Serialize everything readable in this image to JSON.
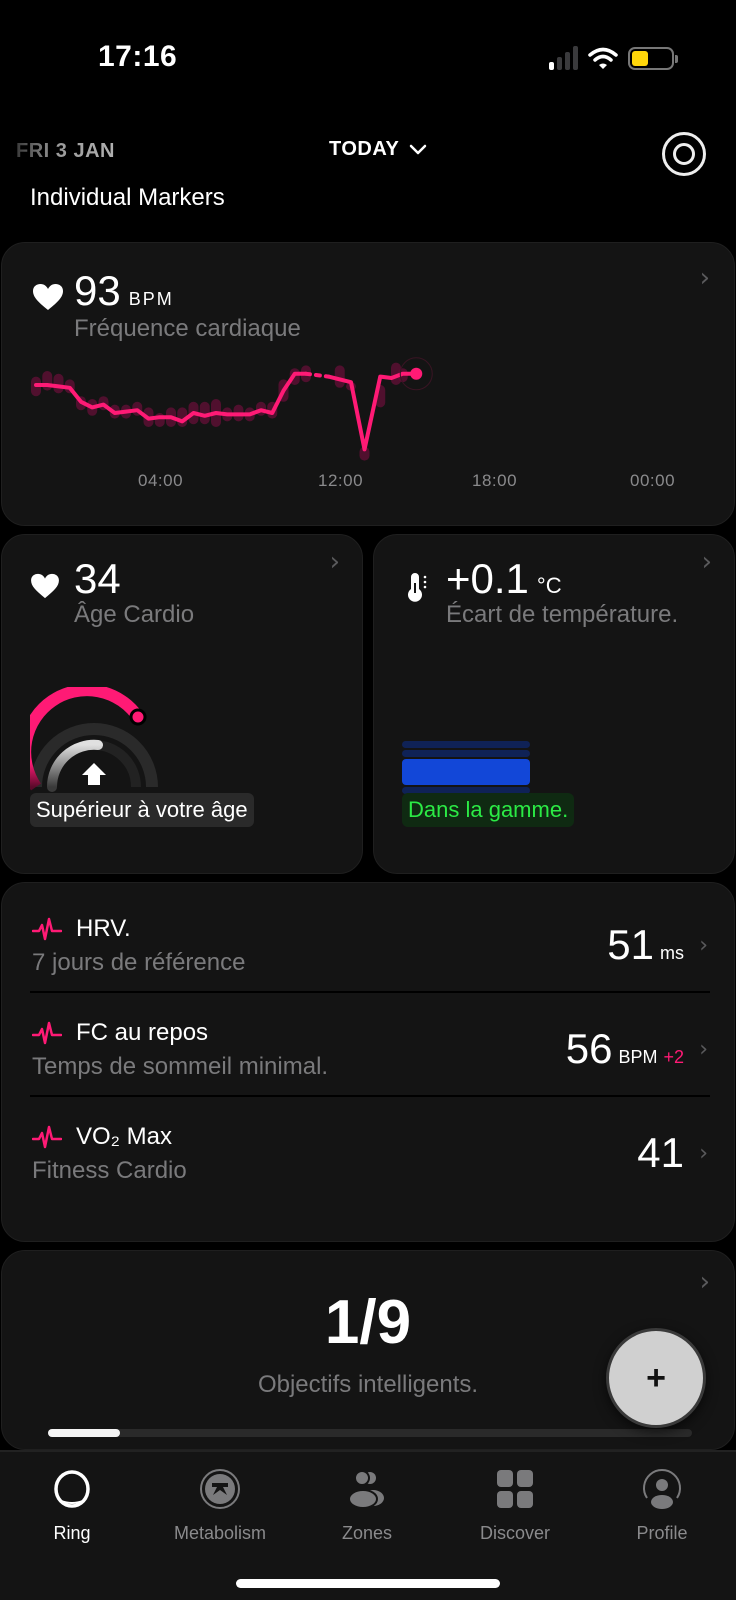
{
  "status_bar": {
    "time": "17:16",
    "signal_bars_active": 1,
    "signal_bars_total": 4,
    "wifi_icon": "wifi-icon",
    "battery_level": 0.35,
    "battery_color": "#ffd60a"
  },
  "header": {
    "date": "FRI 3 JAN",
    "period_selector": "TODAY",
    "ring_icon": "ring-status-icon"
  },
  "section_title": "Individual Markers",
  "heart_rate_card": {
    "icon": "heart-icon",
    "value": "93",
    "unit": "BPM",
    "label": "Fréquence cardiaque",
    "accent": "#ff1a75"
  },
  "chart_data": {
    "type": "line",
    "title": "Fréquence cardiaque",
    "xlabel": "",
    "ylabel": "BPM",
    "x_ticks": [
      "04:00",
      "12:00",
      "18:00",
      "00:00"
    ],
    "x_range_hours": [
      0,
      24
    ],
    "y_range": [
      50,
      100
    ],
    "series": [
      {
        "name": "Heart rate",
        "x_hours": [
          0.0,
          0.5,
          1.0,
          1.5,
          2.0,
          2.5,
          3.0,
          3.5,
          4.0,
          4.5,
          5.0,
          5.5,
          6.0,
          6.5,
          7.0,
          7.5,
          8.0,
          8.5,
          9.0,
          9.5,
          10.0,
          10.5,
          11.0,
          11.5,
          12.0
        ],
        "values": [
          85,
          85,
          84.5,
          84,
          79,
          77,
          78,
          75,
          75.5,
          76,
          73,
          73.5,
          73.5,
          72,
          75,
          74,
          75,
          74.5,
          74.5,
          74.5,
          76,
          75,
          83,
          89,
          89
        ]
      },
      {
        "name": "Heart rate (gap, dotted)",
        "x_hours": [
          12.0,
          13.0
        ],
        "values": [
          89,
          88
        ]
      },
      {
        "name": "Heart rate (afternoon)",
        "x_hours": [
          13.0,
          14.0,
          14.6,
          15.3,
          15.8,
          16.3,
          16.9
        ],
        "values": [
          88,
          86,
          62,
          88,
          87.5,
          89,
          89
        ],
        "current_value": 93
      }
    ],
    "range_bars": {
      "x_hours": [
        0.0,
        0.5,
        1.0,
        1.5,
        2.0,
        2.5,
        3.0,
        3.5,
        4.0,
        4.5,
        5.0,
        5.5,
        6.0,
        6.5,
        7.0,
        7.5,
        8.0,
        8.5,
        9.0,
        9.5,
        10.0,
        10.5,
        11.0,
        11.5,
        12.0,
        13.5,
        14.0,
        14.6,
        15.3,
        16.0,
        16.3
      ],
      "low": [
        81,
        83,
        82,
        82,
        76,
        74,
        76,
        73,
        73,
        74,
        70,
        70,
        70,
        70,
        71,
        71,
        70,
        72,
        72,
        72,
        74,
        73,
        79,
        85,
        86,
        84,
        83,
        58,
        77,
        85,
        86
      ],
      "high": [
        88,
        90,
        89,
        87,
        81,
        80,
        81,
        78,
        78,
        79,
        77,
        75,
        77,
        77,
        79,
        79,
        80,
        77,
        78,
        77,
        79,
        79,
        87,
        91,
        92,
        92,
        86,
        63,
        85,
        93,
        91
      ]
    },
    "grid": false,
    "legend": "none"
  },
  "cardio_age_card": {
    "icon": "heart-icon",
    "value": "34",
    "label": "Âge Cardio",
    "gauge_fraction": 0.65,
    "status": "Supérieur à votre âge"
  },
  "temperature_card": {
    "icon": "thermometer-icon",
    "value": "+0.1",
    "unit": "°C",
    "label": "Écart de température.",
    "status": "Dans la gamme.",
    "status_color": "#2bea45",
    "bar_color": "#1247d8"
  },
  "markers_list": [
    {
      "icon": "pulse-icon",
      "title": "HRV.",
      "subtitle": "7 jours de référence",
      "value": "51",
      "unit": "ms",
      "delta": ""
    },
    {
      "icon": "pulse-icon",
      "title": "FC au repos",
      "subtitle": "Temps de sommeil minimal.",
      "value": "56",
      "unit": "BPM",
      "delta": "+2"
    },
    {
      "icon": "pulse-icon",
      "title": "VO₂ Max",
      "subtitle": "Fitness Cardio",
      "value": "41",
      "unit": "",
      "delta": ""
    }
  ],
  "goals_card": {
    "value": "1/9",
    "label": "Objectifs intelligents.",
    "progress": 0.1111
  },
  "fab": {
    "label": "+"
  },
  "tab_bar": {
    "tabs": [
      {
        "label": "Ring",
        "icon": "ring-icon",
        "active": true
      },
      {
        "label": "Metabolism",
        "icon": "metabolism-icon",
        "active": false
      },
      {
        "label": "Zones",
        "icon": "zones-icon",
        "active": false
      },
      {
        "label": "Discover",
        "icon": "discover-grid-icon",
        "active": false
      },
      {
        "label": "Profile",
        "icon": "profile-icon",
        "active": false
      }
    ]
  }
}
